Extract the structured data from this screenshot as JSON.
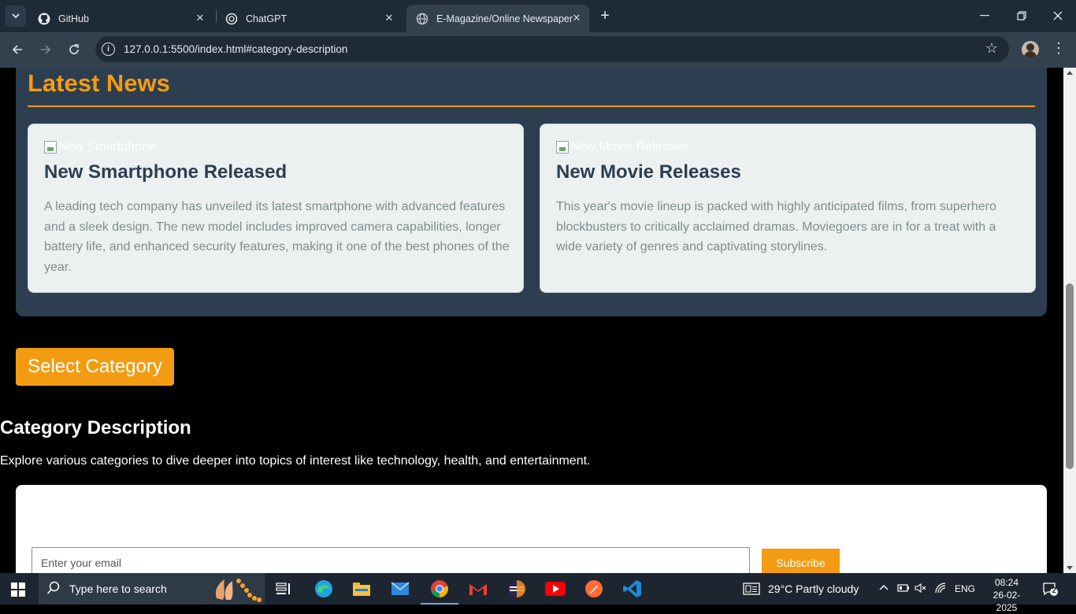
{
  "browser": {
    "tabs": [
      {
        "title": "GitHub",
        "active": false,
        "icon": "github-icon"
      },
      {
        "title": "ChatGPT",
        "active": false,
        "icon": "chatgpt-icon"
      },
      {
        "title": "E-Magazine/Online Newspaper",
        "active": true,
        "icon": "globe-icon"
      }
    ],
    "url": "127.0.0.1:5500/index.html#category-description"
  },
  "page": {
    "latest_news": {
      "title": "Latest News",
      "cards": [
        {
          "img_alt": "New Smartphone",
          "title": "New Smartphone Released",
          "body": "A leading tech company has unveiled its latest smartphone with advanced features and a sleek design. The new model includes improved camera capabilities, longer battery life, and enhanced security features, making it one of the best phones of the year."
        },
        {
          "img_alt": "New Movie Releases",
          "title": "New Movie Releases",
          "body": "This year's movie lineup is packed with highly anticipated films, from superhero blockbusters to critically acclaimed dramas. Moviegoers are in for a treat with a wide variety of genres and captivating storylines."
        }
      ]
    },
    "select_category_label": "Select Category",
    "category_description": {
      "title": "Category Description",
      "text": "Explore various categories to dive deeper into topics of interest like technology, health, and entertainment."
    },
    "newsletter": {
      "email_placeholder": "Enter your email",
      "subscribe_label": "Subscribe"
    }
  },
  "taskbar": {
    "search_placeholder": "Type here to search",
    "weather": "29°C  Partly cloudy",
    "language": "ENG",
    "time": "08:24",
    "date": "26-02-2025",
    "notification_count": "2"
  },
  "colors": {
    "accent": "#f39c12",
    "section_bg": "#2c3e50",
    "card_bg": "#ecf0f1"
  }
}
